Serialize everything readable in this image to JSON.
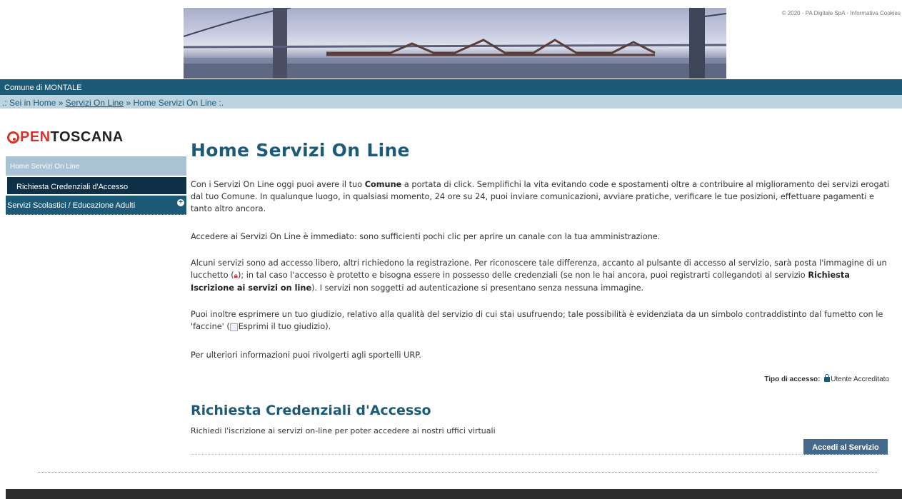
{
  "header": {
    "copyright": "© 2020 - PA Digitale SpA",
    "separator": "-",
    "cookies_link": "Informativa Cookies"
  },
  "comune_bar": {
    "text": "Comune di MONTALE"
  },
  "breadcrumb": {
    "prefix": ".: Sei in Home »",
    "link": "Servizi On Line",
    "suffix": "» Home Servizi On Line :."
  },
  "logo": {
    "brand_accent": "PEN",
    "brand_rest": "TOSCANA"
  },
  "sidebar": {
    "items": [
      {
        "label": "Home Servizi On Line"
      },
      {
        "label": "Richiesta Credenziali d'Accesso"
      },
      {
        "label": "Servizi Scolastici / Educazione Adulti"
      }
    ]
  },
  "main": {
    "title": "Home Servizi On Line",
    "p1_a": "Con i Servizi On Line oggi puoi avere il tuo ",
    "p1_b": "Comune",
    "p1_c": " a portata di click. Semplifichi la vita evitando code e spostamenti oltre a contribuire al miglioramento dei servizi erogati dal tuo Comune. In qualunque luogo, in qualsiasi momento, 24 ore su 24, puoi inviare comunicazioni, avviare pratiche, verificare le tue posizioni, effettuare pagamenti e tanto altro ancora.",
    "p2": "Accedere ai Servizi On Line è immediato: sono sufficienti pochi clic per aprire un canale con la tua amministrazione.",
    "p3_a": "Alcuni servizi sono ad accesso libero, altri richiedono la registrazione. Per riconoscere tale differenza, accanto al pulsante di accesso al servizio, sarà posta l'immagine di un lucchetto (",
    "p3_b": "); in tal caso l'accesso è protetto e bisogna essere in possesso delle credenziali (se non le hai ancora, puoi registrarti collegandoti al servizio ",
    "p3_c": "Richiesta Iscrizione ai servizi on line",
    "p3_d": "). I servizi non soggetti ad autenticazione si presentano senza nessuna immagine.",
    "p4_a": "Puoi inoltre esprimere un tuo giudizio, relativo alla qualità del servizio di cui stai usufruendo; tale possibilità è evidenziata da un simbolo contraddistinto dal fumetto con le 'faccine' (",
    "p4_img_alt": "Esprimi il tuo giudizio",
    "p4_b": ").",
    "p5": "Per ulteriori informazioni puoi rivolgerti agli sportelli URP.",
    "access_label": "Tipo di accesso:",
    "access_value": "Utente Accreditato"
  },
  "service": {
    "title": "Richiesta Credenziali d'Accesso",
    "description": "Richiedi l'iscrizione ai servizi on-line per poter accedere ai nostri uffici virtuali",
    "button": "Accedi al Servizio"
  },
  "colors": {
    "brand_blue": "#1d5a77",
    "breadcrumb_bg": "#bcd3e0",
    "logo_red": "#d8352a",
    "button_bg": "#44698a"
  }
}
